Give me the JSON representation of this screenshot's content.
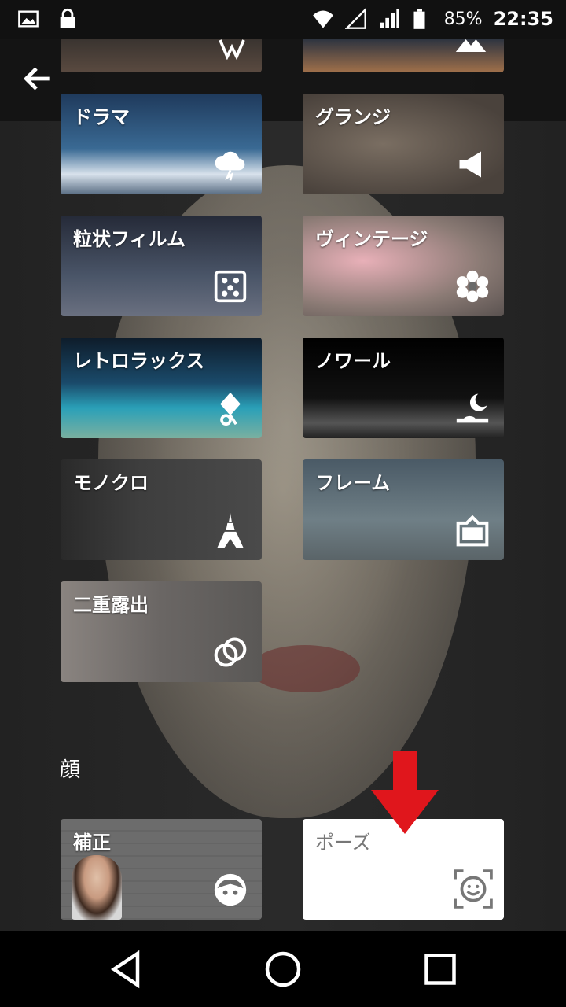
{
  "status_bar": {
    "battery": "85%",
    "time": "22:35"
  },
  "tools": [
    {
      "label": "ドラマ",
      "icon": "cloud-lightning-icon"
    },
    {
      "label": "グランジ",
      "icon": "megaphone-icon"
    },
    {
      "label": "粒状フィルム",
      "icon": "dice-icon"
    },
    {
      "label": "ヴィンテージ",
      "icon": "flower-icon"
    },
    {
      "label": "レトロラックス",
      "icon": "kite-icon"
    },
    {
      "label": "ノワール",
      "icon": "moon-icon"
    },
    {
      "label": "モノクロ",
      "icon": "eiffel-tower-icon"
    },
    {
      "label": "フレーム",
      "icon": "frame-icon"
    },
    {
      "label": "二重露出",
      "icon": "double-circle-icon"
    }
  ],
  "face_section": {
    "title": "顔",
    "tools": [
      {
        "label": "補正",
        "icon": "face-icon"
      },
      {
        "label": "ポーズ",
        "icon": "face-frame-icon"
      }
    ]
  },
  "colors": {
    "accent_arrow": "#e0161c",
    "tile_label": "#ffffff",
    "pose_label": "#777777"
  }
}
